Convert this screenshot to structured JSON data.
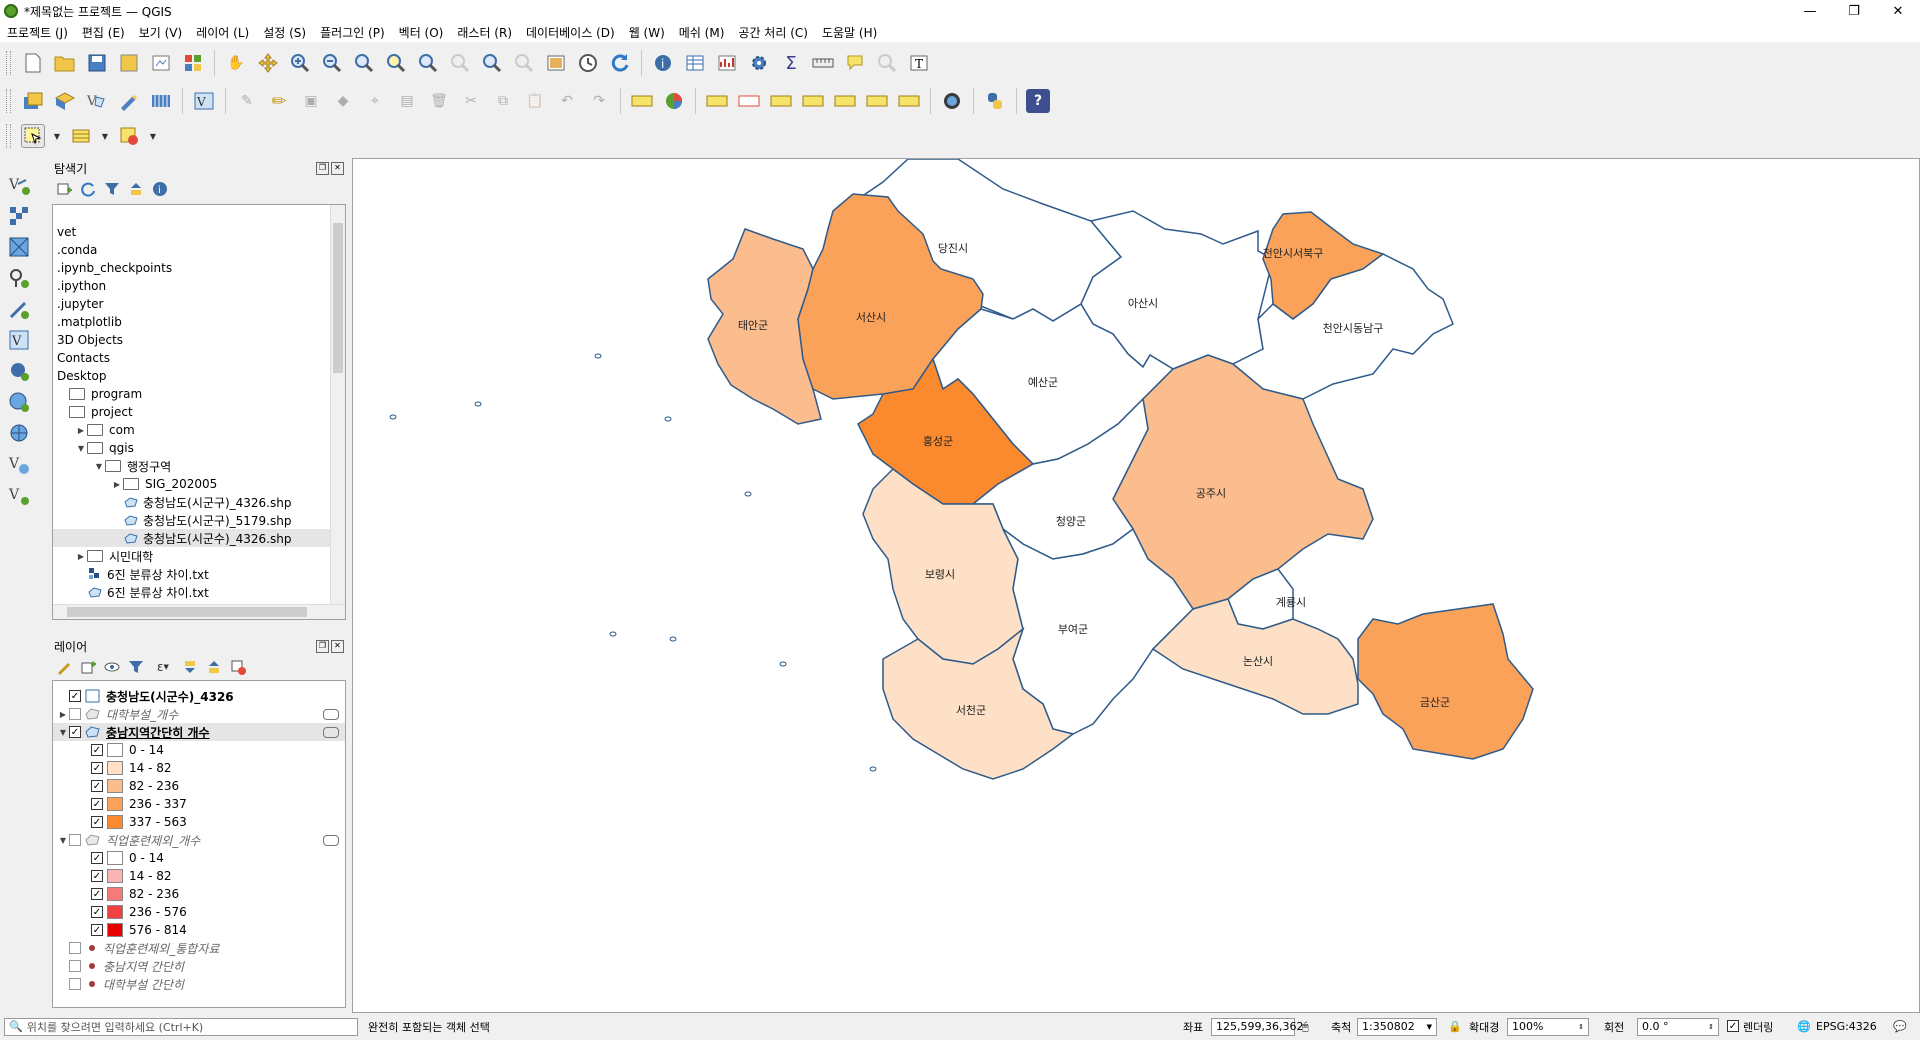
{
  "window": {
    "title": "*제목없는 프로젝트 — QGIS",
    "minimize": "—",
    "maximize": "❐",
    "close": "✕"
  },
  "menu": [
    "프로젝트 (J)",
    "편집 (E)",
    "보기 (V)",
    "레이어 (L)",
    "설정 (S)",
    "플러그인 (P)",
    "벡터 (O)",
    "래스터 (R)",
    "데이터베이스 (D)",
    "웹 (W)",
    "메쉬 (M)",
    "공간 처리 (C)",
    "도움말 (H)"
  ],
  "browser": {
    "title": "탐색기",
    "items": [
      {
        "label": "vet",
        "depth": 0,
        "arrow": "",
        "icon": "none"
      },
      {
        "label": ".conda",
        "depth": 0,
        "arrow": "",
        "icon": "none"
      },
      {
        "label": ".ipynb_checkpoints",
        "depth": 0,
        "arrow": "",
        "icon": "none"
      },
      {
        "label": ".ipython",
        "depth": 0,
        "arrow": "",
        "icon": "none"
      },
      {
        "label": ".jupyter",
        "depth": 0,
        "arrow": "",
        "icon": "none"
      },
      {
        "label": ".matplotlib",
        "depth": 0,
        "arrow": "",
        "icon": "none"
      },
      {
        "label": "3D Objects",
        "depth": 0,
        "arrow": "",
        "icon": "none"
      },
      {
        "label": "Contacts",
        "depth": 0,
        "arrow": "",
        "icon": "none"
      },
      {
        "label": "Desktop",
        "depth": 0,
        "arrow": "",
        "icon": "none"
      },
      {
        "label": "program",
        "depth": 0,
        "arrow": "",
        "icon": "folder"
      },
      {
        "label": "project",
        "depth": 0,
        "arrow": "",
        "icon": "folder"
      },
      {
        "label": "com",
        "depth": 1,
        "arrow": "▶",
        "icon": "folder"
      },
      {
        "label": "qgis",
        "depth": 1,
        "arrow": "▼",
        "icon": "folder"
      },
      {
        "label": "행정구역",
        "depth": 2,
        "arrow": "▼",
        "icon": "folder"
      },
      {
        "label": "SIG_202005",
        "depth": 3,
        "arrow": "▶",
        "icon": "folder"
      },
      {
        "label": "충청남도(시군구)_4326.shp",
        "depth": 3,
        "arrow": "",
        "icon": "shp"
      },
      {
        "label": "충청남도(시군구)_5179.shp",
        "depth": 3,
        "arrow": "",
        "icon": "shp"
      },
      {
        "label": "충청남도(시군수)_4326.shp",
        "depth": 3,
        "arrow": "",
        "icon": "shp",
        "selected": true
      },
      {
        "label": "시민대학",
        "depth": 1,
        "arrow": "▶",
        "icon": "folder"
      },
      {
        "label": "6진 분류상 차이.txt",
        "depth": 1,
        "arrow": "",
        "icon": "grid"
      },
      {
        "label": "6진 분류상 차이.txt",
        "depth": 1,
        "arrow": "",
        "icon": "shp"
      }
    ]
  },
  "layers": {
    "title": "레이어",
    "items": [
      {
        "type": "layer",
        "label": "충청남도(시군수)_4326",
        "checked": true,
        "arrow": "",
        "style": "bold",
        "symbol": "poly-white"
      },
      {
        "type": "layer",
        "label": "대학부설_개수",
        "checked": false,
        "arrow": "▶",
        "style": "italic",
        "symbol": "poly-grey",
        "eye": true
      },
      {
        "type": "layer",
        "label": "충남지역간단히 개수",
        "checked": true,
        "arrow": "▼",
        "style": "bold-underline",
        "symbol": "poly-blue",
        "eye": true
      },
      {
        "type": "class",
        "label": "0 - 14",
        "checked": true,
        "color": "#ffffff"
      },
      {
        "type": "class",
        "label": "14 - 82",
        "checked": true,
        "color": "#fde0c5"
      },
      {
        "type": "class",
        "label": "82 - 236",
        "checked": true,
        "color": "#fbbd8d"
      },
      {
        "type": "class",
        "label": "236 - 337",
        "checked": true,
        "color": "#fba25a"
      },
      {
        "type": "class",
        "label": "337 - 563",
        "checked": true,
        "color": "#fb8a2e"
      },
      {
        "type": "layer",
        "label": "직업훈련제외_개수",
        "checked": false,
        "arrow": "▼",
        "style": "italic",
        "symbol": "poly-grey",
        "eye": true
      },
      {
        "type": "class",
        "label": "0 - 14",
        "checked": true,
        "color": "#ffffff"
      },
      {
        "type": "class",
        "label": "14 - 82",
        "checked": true,
        "color": "#f9b4b4"
      },
      {
        "type": "class",
        "label": "82 - 236",
        "checked": true,
        "color": "#f57a7a"
      },
      {
        "type": "class",
        "label": "236 - 576",
        "checked": true,
        "color": "#f04040"
      },
      {
        "type": "class",
        "label": "576 - 814",
        "checked": true,
        "color": "#e80000"
      },
      {
        "type": "point",
        "label": "직업훈련제외_통합자료",
        "checked": false
      },
      {
        "type": "point",
        "label": "충남지역 간단히",
        "checked": false
      },
      {
        "type": "point",
        "label": "대학부설 간단히",
        "checked": false
      }
    ]
  },
  "map": {
    "border_color": "#2f5b8a",
    "regions": [
      {
        "name": "당진시",
        "fill": "#ffffff"
      },
      {
        "name": "아산시",
        "fill": "#ffffff"
      },
      {
        "name": "천안시서북구",
        "fill": "#fba25a"
      },
      {
        "name": "천안시동남구",
        "fill": "#ffffff"
      },
      {
        "name": "태안군",
        "fill": "#fbbd8d"
      },
      {
        "name": "서산시",
        "fill": "#fba25a"
      },
      {
        "name": "예산군",
        "fill": "#ffffff"
      },
      {
        "name": "홍성군",
        "fill": "#fb8a2e"
      },
      {
        "name": "공주시",
        "fill": "#fbbd8d"
      },
      {
        "name": "청양군",
        "fill": "#ffffff"
      },
      {
        "name": "보령시",
        "fill": "#fde0c5"
      },
      {
        "name": "부여군",
        "fill": "#ffffff"
      },
      {
        "name": "계룡시",
        "fill": "#ffffff"
      },
      {
        "name": "논산시",
        "fill": "#fde0c5"
      },
      {
        "name": "금산군",
        "fill": "#fba25a"
      },
      {
        "name": "서천군",
        "fill": "#fde0c5"
      }
    ]
  },
  "status": {
    "search_placeholder": "위치를 찾으려면 입력하세요 (Ctrl+K)",
    "message": "완전히 포함되는 객체 선택",
    "coord_label": "좌표",
    "coord_value": "125,599,36,362",
    "scale_label": "축척",
    "scale_value": "1:350802",
    "magnifier_label": "확대경",
    "magnifier_value": "100%",
    "rotation_label": "회전",
    "rotation_value": "0.0 °",
    "render_label": "렌더링",
    "crs": "EPSG:4326"
  }
}
